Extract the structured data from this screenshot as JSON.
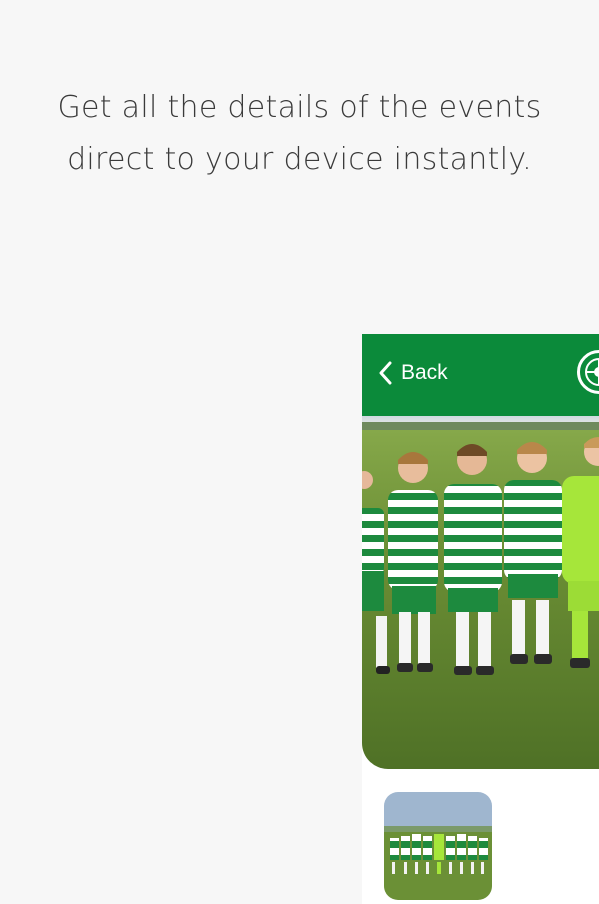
{
  "intro": {
    "line1": "Get all the details of the events",
    "line2": "direct to your device instantly."
  },
  "app": {
    "back_label": "Back",
    "header_color": "#0b8a3a",
    "crest_icon": "club-crest-icon",
    "back_icon": "chevron-left-icon",
    "hero_image": "team-photo",
    "thumbnail_image": "team-photo-thumbnail"
  }
}
